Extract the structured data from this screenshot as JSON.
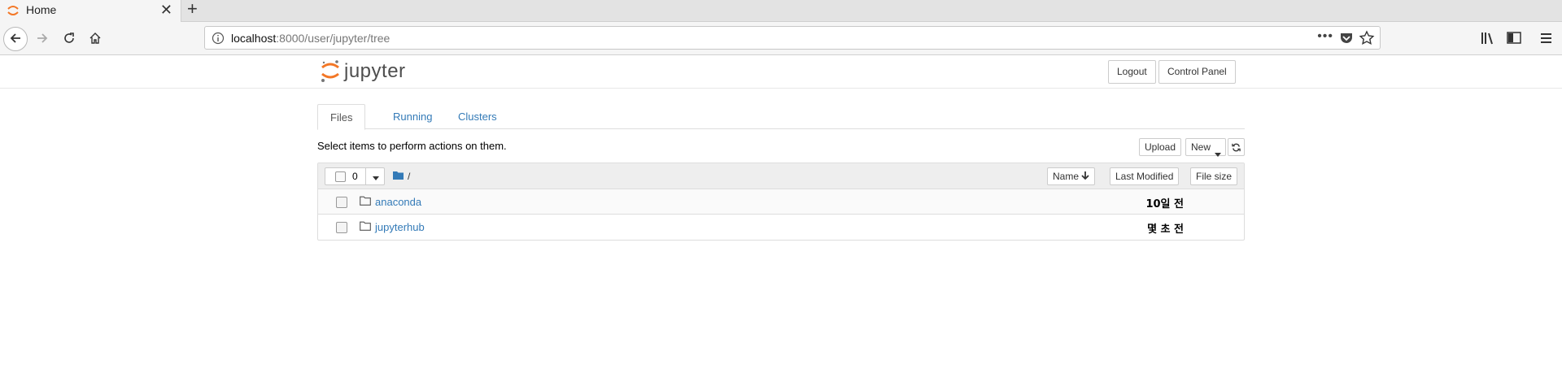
{
  "browser": {
    "tab_title": "Home",
    "close_glyph": "✕",
    "newtab_glyph": "+",
    "url_host": "localhost",
    "url_rest": ":8000/user/jupyter/tree",
    "more_glyph": "•••"
  },
  "header": {
    "logo_text": "jupyter",
    "logout_label": "Logout",
    "control_panel_label": "Control Panel"
  },
  "tabs": [
    {
      "label": "Files"
    },
    {
      "label": "Running"
    },
    {
      "label": "Clusters"
    }
  ],
  "toolbar": {
    "instruction": "Select items to perform actions on them.",
    "upload_label": "Upload",
    "new_label": "New"
  },
  "list": {
    "selected_count": "0",
    "breadcrumb": "/",
    "sort_name_label": "Name",
    "sort_modified_label": "Last Modified",
    "sort_size_label": "File size",
    "rows": [
      {
        "name": "anaconda",
        "modified": "10일 전"
      },
      {
        "name": "jupyterhub",
        "modified": "몇 초 전"
      }
    ]
  },
  "colors": {
    "link": "#337ab7",
    "jupyter_orange": "#f37726"
  }
}
